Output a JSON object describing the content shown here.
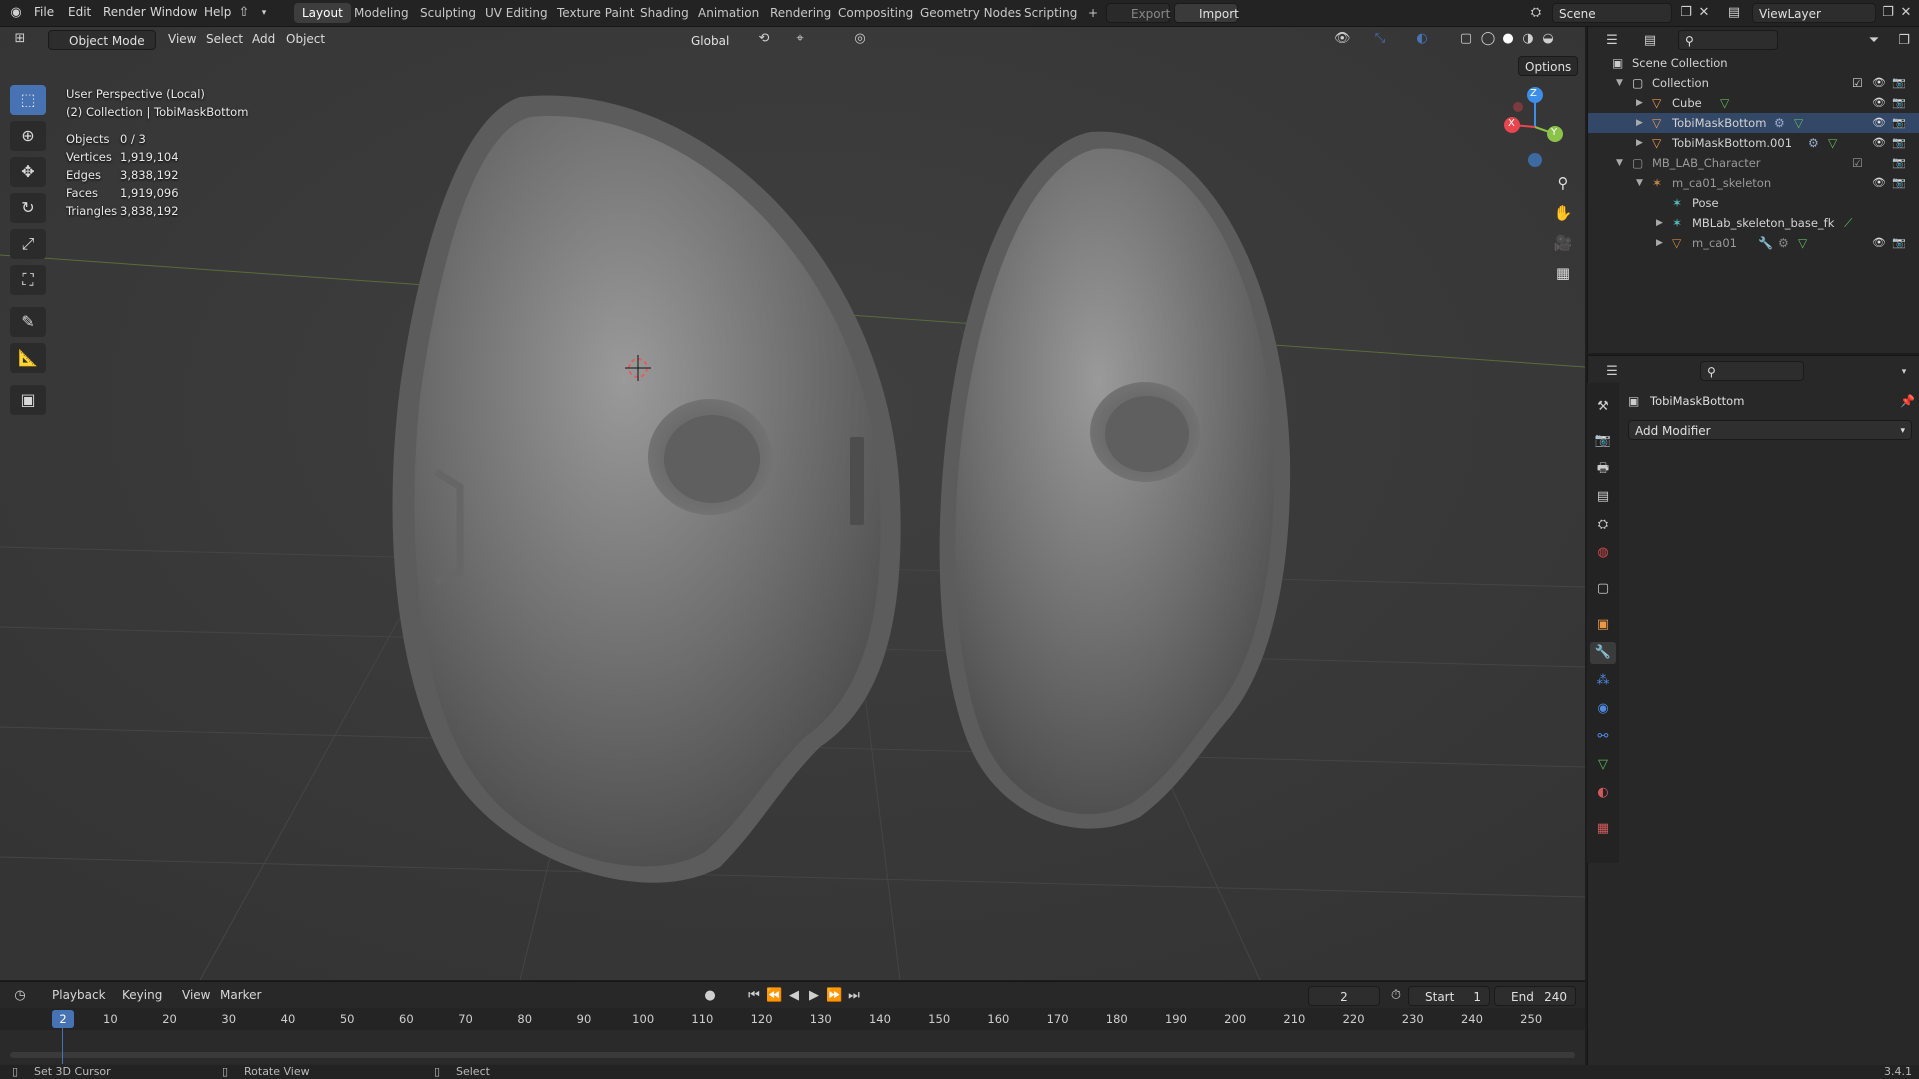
{
  "topbar": {
    "menus": [
      "File",
      "Edit",
      "Render",
      "Window",
      "Help"
    ],
    "workspaces": [
      "Layout",
      "Modeling",
      "Sculpting",
      "UV Editing",
      "Texture Paint",
      "Shading",
      "Animation",
      "Rendering",
      "Compositing",
      "Geometry Nodes",
      "Scripting"
    ],
    "active_workspace": "Layout",
    "add_workspace": "+",
    "export_label": "Export",
    "import_label": "Import",
    "scene_name": "Scene",
    "view_layer": "ViewLayer"
  },
  "viewport_header": {
    "mode": "Object Mode",
    "menus": [
      "View",
      "Select",
      "Add",
      "Object"
    ],
    "orientation": "Global",
    "options_label": "Options"
  },
  "overlay": {
    "view_name": "User Perspective (Local)",
    "collection_info": "(2) Collection | TobiMaskBottom",
    "stats": [
      {
        "label": "Objects",
        "value": "0 / 3"
      },
      {
        "label": "Vertices",
        "value": "1,919,104"
      },
      {
        "label": "Edges",
        "value": "3,838,192"
      },
      {
        "label": "Faces",
        "value": "1,919,096"
      },
      {
        "label": "Triangles",
        "value": "3,838,192"
      }
    ]
  },
  "gizmo": {
    "z": "Z",
    "y": "Y",
    "x": "X"
  },
  "outliner": {
    "root": "Scene Collection",
    "items": [
      {
        "label": "Collection",
        "indent": 1,
        "kind": "collection"
      },
      {
        "label": "Cube",
        "indent": 2,
        "kind": "mesh"
      },
      {
        "label": "TobiMaskBottom",
        "indent": 2,
        "kind": "mesh"
      },
      {
        "label": "TobiMaskBottom.001",
        "indent": 2,
        "kind": "mesh"
      },
      {
        "label": "MB_LAB_Character",
        "indent": 1,
        "kind": "collection"
      },
      {
        "label": "m_ca01_skeleton",
        "indent": 2,
        "kind": "armature"
      },
      {
        "label": "Pose",
        "indent": 3,
        "kind": "pose"
      },
      {
        "label": "MBLab_skeleton_base_fk",
        "indent": 3,
        "kind": "armature"
      },
      {
        "label": "m_ca01",
        "indent": 3,
        "kind": "mesh"
      }
    ]
  },
  "properties": {
    "object_name": "TobiMaskBottom",
    "add_modifier": "Add Modifier"
  },
  "timeline": {
    "menus": [
      "Playback",
      "Keying",
      "View",
      "Marker"
    ],
    "current_frame": "2",
    "start_label": "Start",
    "start_value": "1",
    "end_label": "End",
    "end_value": "240",
    "ticks": [
      "2",
      "10",
      "20",
      "30",
      "40",
      "50",
      "60",
      "70",
      "80",
      "90",
      "100",
      "110",
      "120",
      "130",
      "140",
      "150",
      "160",
      "170",
      "180",
      "190",
      "200",
      "210",
      "220",
      "230",
      "240",
      "250"
    ]
  },
  "statusbar": {
    "hint1": "Set 3D Cursor",
    "hint2": "Rotate View",
    "hint3": "Select",
    "version": "3.4.1"
  },
  "colors": {
    "accent": "#4772b3",
    "viewport_bg": "#3a3a3a",
    "panel_bg": "#282828",
    "gizmo_x": "#e8454f",
    "gizmo_y": "#8bc34a",
    "gizmo_z": "#3d8ee6"
  }
}
